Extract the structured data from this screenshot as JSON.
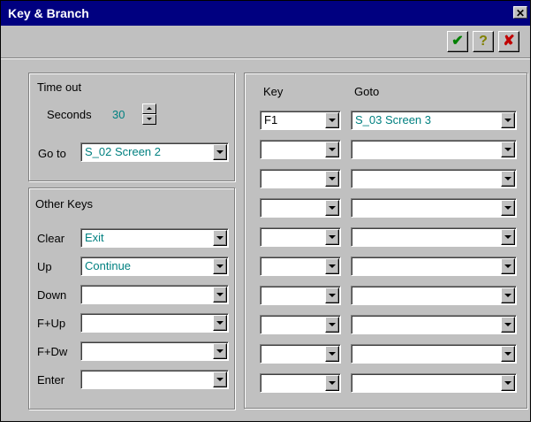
{
  "window": {
    "title": "Key & Branch",
    "close_glyph": "✕"
  },
  "toolbar": {
    "ok_glyph": "✔",
    "help_glyph": "?",
    "cancel_glyph": "✘",
    "ok_color": "#008000",
    "help_color": "#808000",
    "cancel_color": "#c00000"
  },
  "timeout": {
    "group_label": "Time out",
    "seconds_label": "Seconds",
    "seconds_value": "30",
    "goto_label": "Go to",
    "goto_value": "S_02  Screen 2"
  },
  "other_keys": {
    "group_label": "Other Keys",
    "rows": [
      {
        "label": "Clear",
        "value": "Exit"
      },
      {
        "label": "Up",
        "value": "Continue"
      },
      {
        "label": "Down",
        "value": ""
      },
      {
        "label": "F+Up",
        "value": ""
      },
      {
        "label": "F+Dw",
        "value": ""
      },
      {
        "label": "Enter",
        "value": ""
      }
    ]
  },
  "key_goto": {
    "key_header": "Key",
    "goto_header": "Goto",
    "rows": [
      {
        "key": "F1",
        "goto": "S_03  Screen 3"
      },
      {
        "key": "",
        "goto": ""
      },
      {
        "key": "",
        "goto": ""
      },
      {
        "key": "",
        "goto": ""
      },
      {
        "key": "",
        "goto": ""
      },
      {
        "key": "",
        "goto": ""
      },
      {
        "key": "",
        "goto": ""
      },
      {
        "key": "",
        "goto": ""
      },
      {
        "key": "",
        "goto": ""
      },
      {
        "key": "",
        "goto": ""
      }
    ]
  }
}
